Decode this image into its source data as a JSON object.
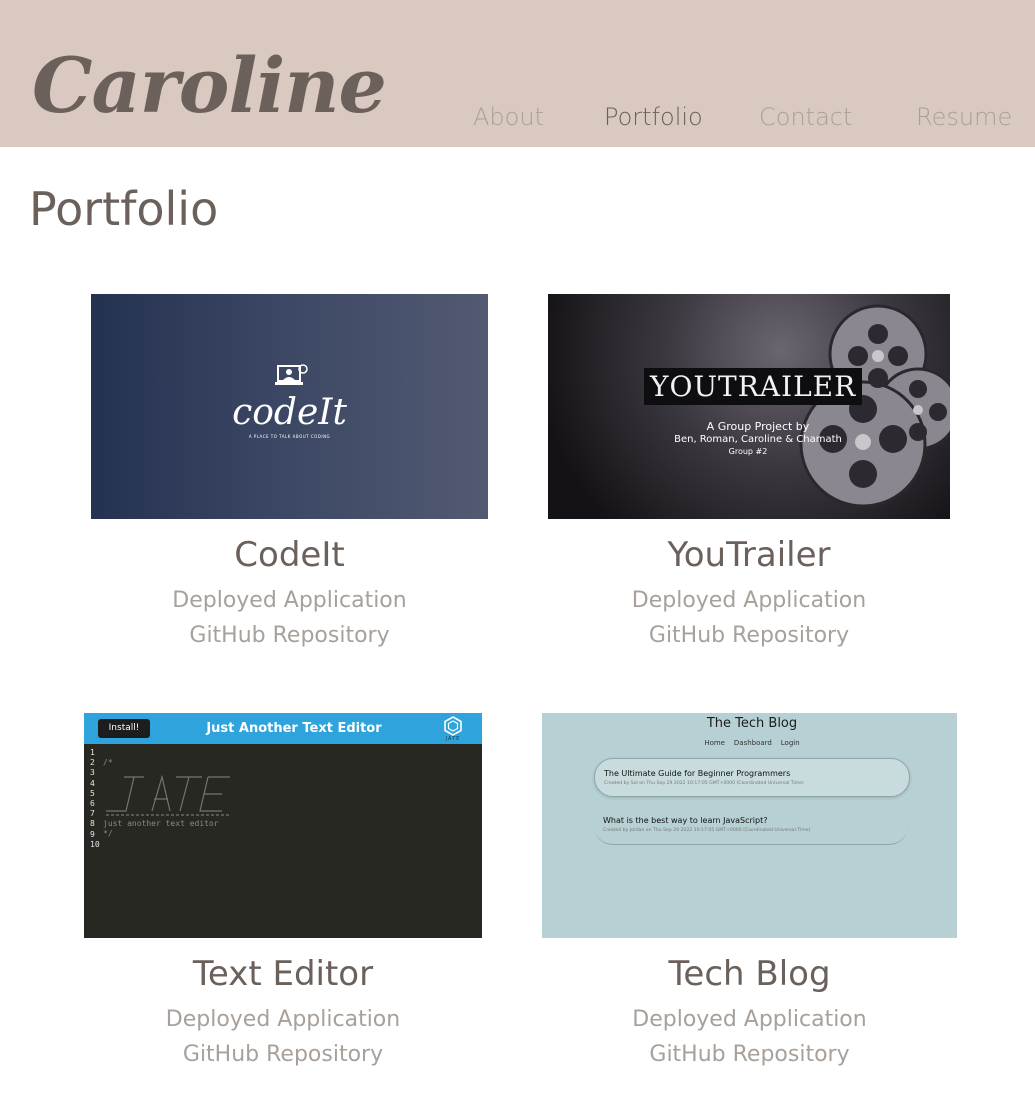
{
  "header": {
    "logo": "Caroline",
    "nav": [
      {
        "label": "About",
        "active": false
      },
      {
        "label": "Portfolio",
        "active": true
      },
      {
        "label": "Contact",
        "active": false
      },
      {
        "label": "Resume",
        "active": false
      }
    ]
  },
  "main": {
    "title": "Portfolio",
    "projects": [
      {
        "name": "CodeIt",
        "deployed_label": "Deployed Application",
        "repo_label": "GitHub Repository",
        "thumb": {
          "logo": "codeIt",
          "tagline": "A PLACE TO TALK ABOUT CODING"
        }
      },
      {
        "name": "YouTrailer",
        "deployed_label": "Deployed Application",
        "repo_label": "GitHub Repository",
        "thumb": {
          "title": "YOUTRAILER",
          "line1": "A Group Project by",
          "line2": "Ben, Roman, Caroline & Chamath",
          "line3": "Group #2"
        }
      },
      {
        "name": "Text Editor",
        "deployed_label": "Deployed Application",
        "repo_label": "GitHub Repository",
        "thumb": {
          "install": "Install!",
          "title": "Just Another Text Editor",
          "brand": "JATE",
          "line_numbers": [
            "1",
            "2",
            "3",
            "4",
            "5",
            "6",
            "7",
            "8",
            "9",
            "10"
          ],
          "code_open": "/*",
          "code_text": "just another text editor",
          "code_close": "*/"
        }
      },
      {
        "name": "Tech Blog",
        "deployed_label": "Deployed Application",
        "repo_label": "GitHub Repository",
        "thumb": {
          "title": "The Tech Blog",
          "nav": [
            "Home",
            "Dashboard",
            "Login"
          ],
          "posts": [
            {
              "title": "The Ultimate Guide for Beginner Programmers",
              "meta": "Created by Sol on Thu Sep 29 2022 10:17:05 GMT+0000 (Coordinated Universal Time)"
            },
            {
              "title": "What is the best way to learn JavaScript?",
              "meta": "Created by Jordan on Thu Sep 29 2022 10:17:05 GMT+0000 (Coordinated Universal Time)"
            }
          ]
        }
      }
    ]
  },
  "colors": {
    "header_bg": "#d9c9c0",
    "heading": "#6b605a",
    "muted": "#a8a09a"
  }
}
